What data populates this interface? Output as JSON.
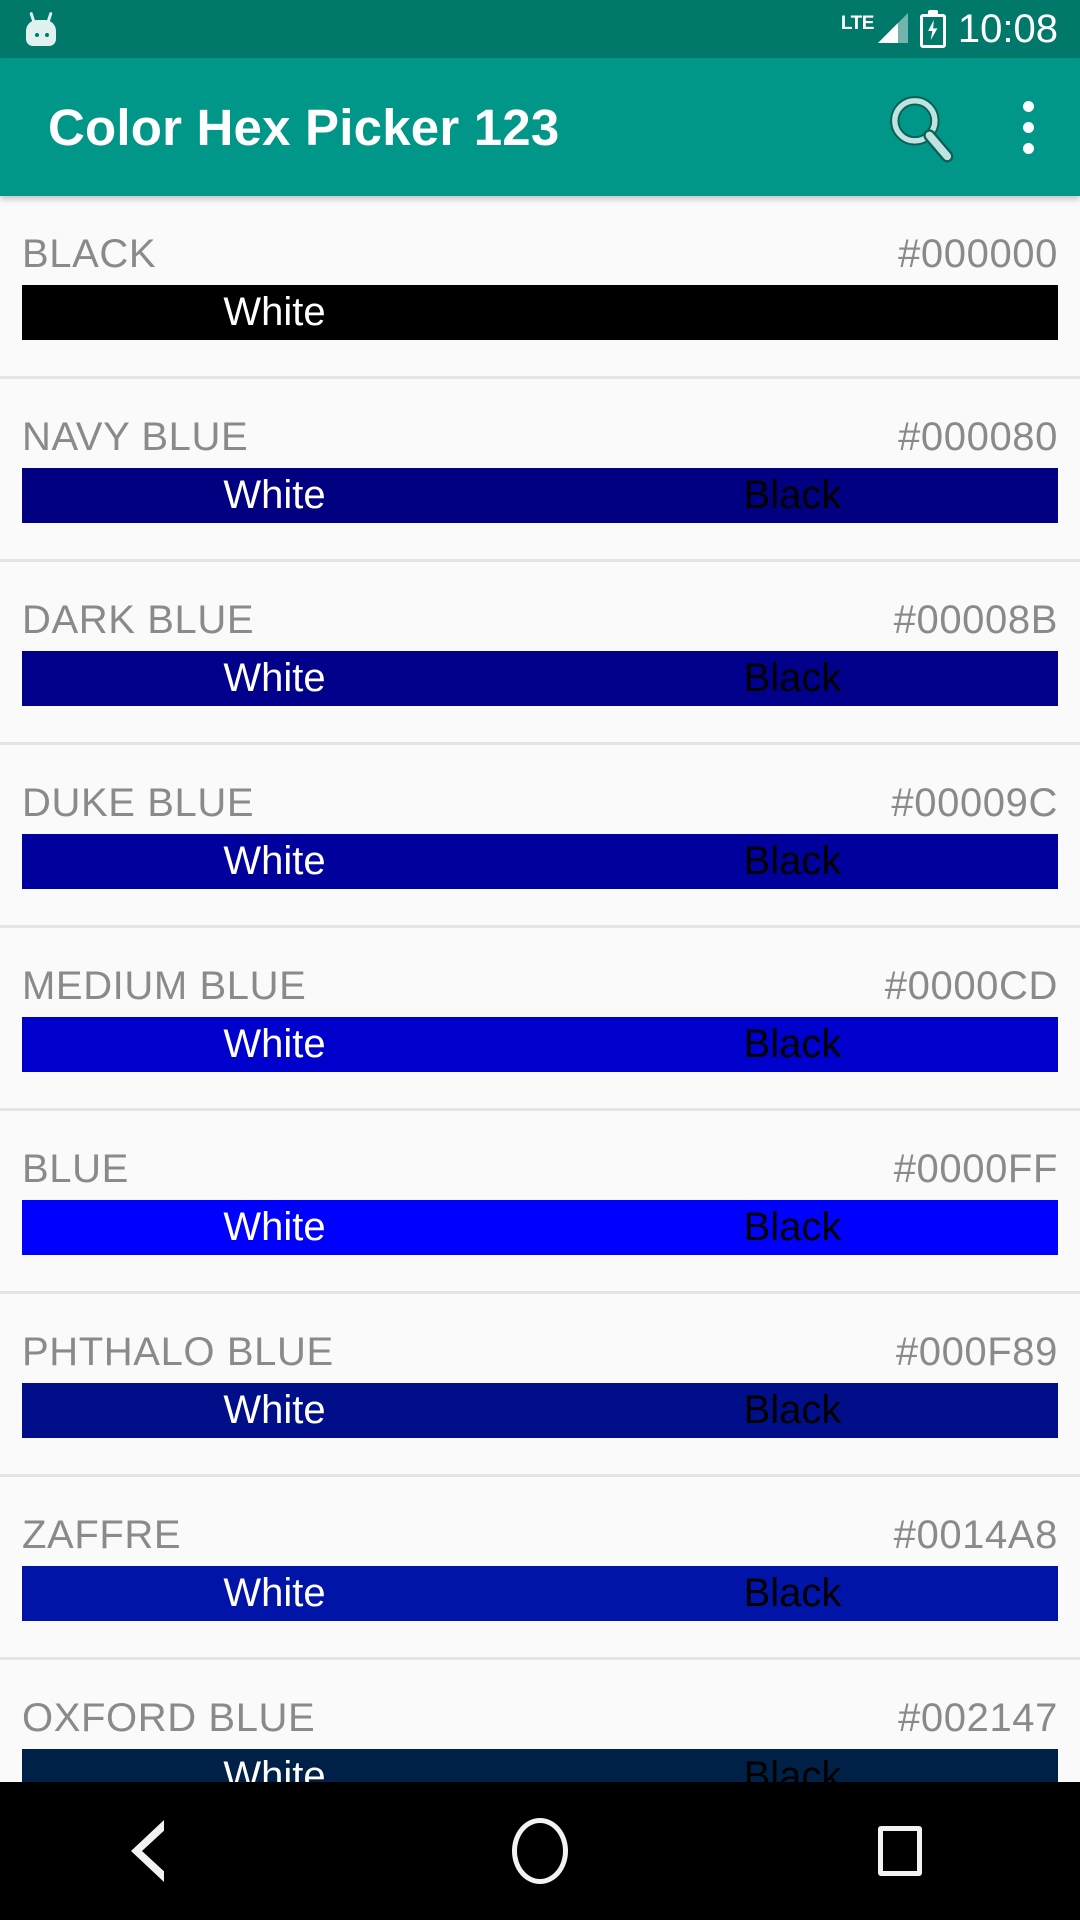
{
  "statusbar": {
    "notification_icon": "android-mascot-icon",
    "network_type": "LTE",
    "signal_icon": "signal-bars-icon",
    "battery_icon": "battery-charging-icon",
    "time": "10:08"
  },
  "appbar": {
    "title": "Color Hex Picker 123",
    "search_icon": "search-icon",
    "overflow_icon": "more-vert-icon",
    "background": "#009688"
  },
  "labels": {
    "white": "White",
    "black": "Black"
  },
  "list": {
    "rows": [
      {
        "name": "BLACK",
        "hex": "#000000",
        "swatch": "#000000",
        "show_black_label": false
      },
      {
        "name": "NAVY BLUE",
        "hex": "#000080",
        "swatch": "#000080",
        "show_black_label": true
      },
      {
        "name": "DARK BLUE",
        "hex": "#00008B",
        "swatch": "#00008B",
        "show_black_label": true
      },
      {
        "name": "DUKE BLUE",
        "hex": "#00009C",
        "swatch": "#00009C",
        "show_black_label": true
      },
      {
        "name": "MEDIUM BLUE",
        "hex": "#0000CD",
        "swatch": "#0000CD",
        "show_black_label": true
      },
      {
        "name": "BLUE",
        "hex": "#0000FF",
        "swatch": "#0000FF",
        "show_black_label": true
      },
      {
        "name": "PHTHALO BLUE",
        "hex": "#000F89",
        "swatch": "#000F89",
        "show_black_label": true
      },
      {
        "name": "ZAFFRE",
        "hex": "#0014A8",
        "swatch": "#0014A8",
        "show_black_label": true
      },
      {
        "name": "OXFORD BLUE",
        "hex": "#002147",
        "swatch": "#002147",
        "show_black_label": true
      }
    ]
  },
  "navbar": {
    "back_icon": "back-triangle-icon",
    "home_icon": "home-circle-icon",
    "recents_icon": "recents-square-icon"
  }
}
